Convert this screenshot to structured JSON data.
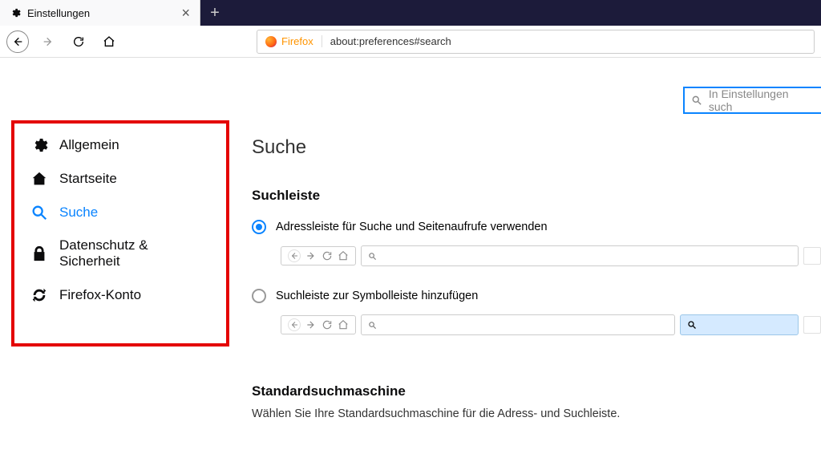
{
  "tab": {
    "title": "Einstellungen"
  },
  "urlbar": {
    "brand": "Firefox",
    "address": "about:preferences#search"
  },
  "sidebar": {
    "items": [
      {
        "label": "Allgemein"
      },
      {
        "label": "Startseite"
      },
      {
        "label": "Suche"
      },
      {
        "label": "Datenschutz & Sicherheit"
      },
      {
        "label": "Firefox-Konto"
      }
    ]
  },
  "search": {
    "placeholder": "In Einstellungen such"
  },
  "main": {
    "title": "Suche",
    "section1": {
      "heading": "Suchleiste",
      "opt1": "Adressleiste für Suche und Seitenaufrufe verwenden",
      "opt2": "Suchleiste zur Symbolleiste hinzufügen"
    },
    "section2": {
      "heading": "Standardsuchmaschine",
      "desc": "Wählen Sie Ihre Standardsuchmaschine für die Adress- und Suchleiste."
    }
  }
}
